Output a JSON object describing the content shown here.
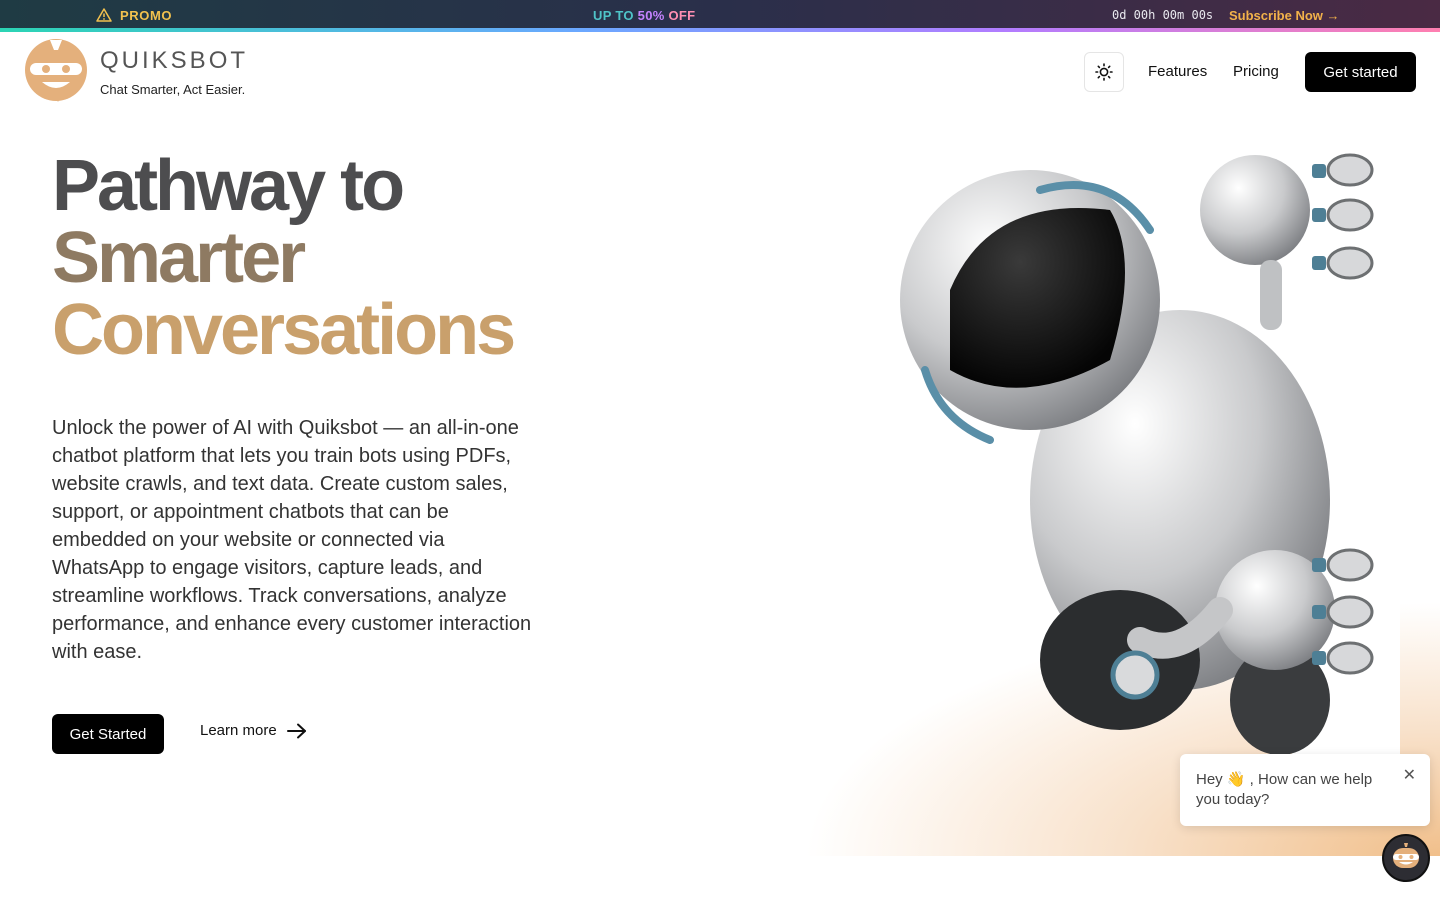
{
  "promo": {
    "label": "PROMO",
    "offer_prefix": "UP TO ",
    "offer_pct": "50% ",
    "offer_suffix": "OFF",
    "timer": "0d 00h 00m 00s",
    "subscribe": "Subscribe Now →",
    "icon": "warning-triangle-icon"
  },
  "header": {
    "brand": "QUIKSBOT",
    "tagline": "Chat Smarter, Act Easier.",
    "theme_icon": "sun-icon",
    "nav": {
      "features": "Features",
      "pricing": "Pricing"
    },
    "cta": "Get started"
  },
  "hero": {
    "title_line1": "Pathway to",
    "title_line2": "Smarter",
    "title_line3": "Conversations",
    "description": "Unlock the power of AI with Quiksbot — an all-in-one chatbot platform that lets you train bots using PDFs, website crawls, and text data. Create custom sales, support, or appointment chatbots that can be embedded on your website or connected via WhatsApp to engage visitors, capture leads, and streamline workflows. Track conversations, analyze performance, and enhance every customer interaction with ease.",
    "primary_cta": "Get Started",
    "secondary_cta": "Learn more"
  },
  "chat": {
    "message": "Hey 👋 , How can we help you today?",
    "close": "✕"
  },
  "colors": {
    "accent_gold": "#c9a06c",
    "title_gray": "#4d4d4f",
    "button_black": "#000000",
    "promo_yellow": "#f2c14e"
  }
}
